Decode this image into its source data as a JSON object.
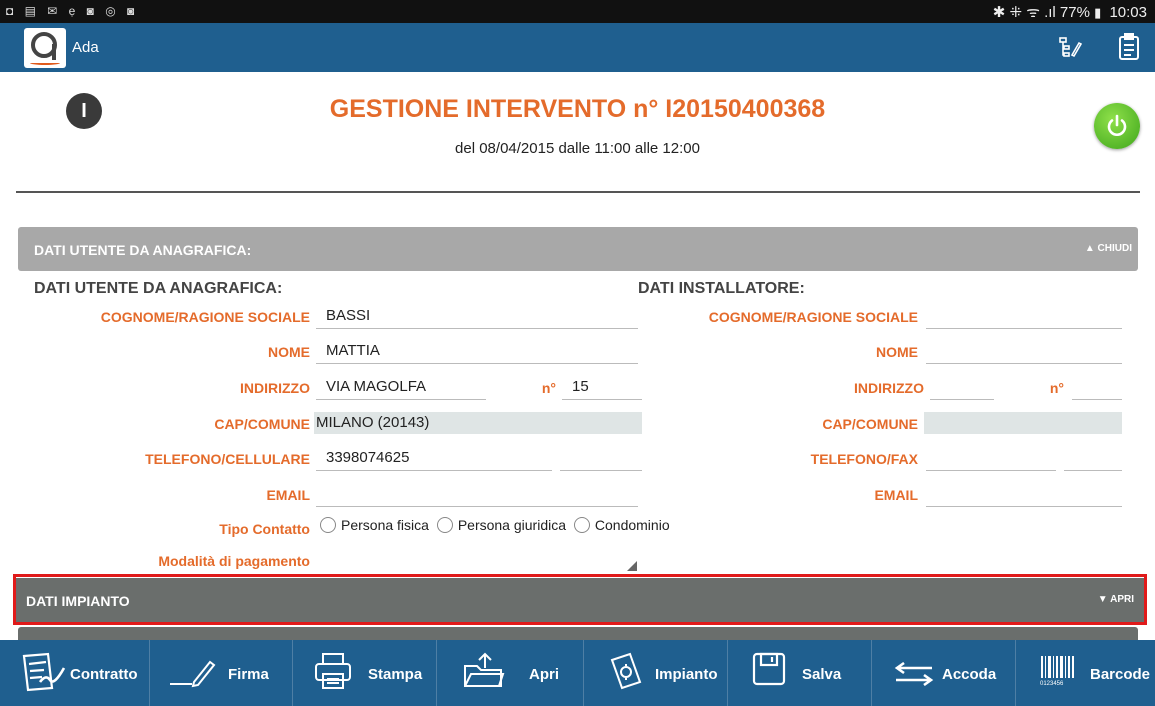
{
  "statusbar": {
    "left_icons": "◘ ▤ ✉ ẹ ◙ ◎ ◙",
    "signal": "✱ ⁜ ᯤ .ıl",
    "battery": "77%",
    "battery_icon": "▮",
    "time": "10:03"
  },
  "app": {
    "name": "Ada",
    "logo_letter": "a",
    "accent": "#1f5f8f",
    "orange": "#e46b2b"
  },
  "header": {
    "info_icon": "I",
    "title": "GESTIONE INTERVENTO n° I20150400368",
    "subtitle": "del 08/04/2015 dalle 11:00 alle 12:00"
  },
  "section_anagrafica": {
    "label": "DATI UTENTE DA ANAGRAFICA:",
    "toggle": "CHIUDI"
  },
  "utente": {
    "heading": "DATI UTENTE DA ANAGRAFICA:",
    "cognome_label": "COGNOME/RAGIONE SOCIALE",
    "cognome": "BASSI",
    "nome_label": "NOME",
    "nome": "MATTIA",
    "indirizzo_label": "INDIRIZZO",
    "indirizzo": "VIA MAGOLFA",
    "numero_label": "n°",
    "numero": "15",
    "cap_label": "CAP/COMUNE",
    "cap": "MILANO (20143)",
    "telefono_label": "TELEFONO/CELLULARE",
    "telefono": "3398074625",
    "cellulare": "",
    "email_label": "EMAIL",
    "email": "",
    "tipo_label": "Tipo Contatto",
    "tipo_options": [
      "Persona fisica",
      "Persona giuridica",
      "Condominio"
    ],
    "pagamento_label": "Modalità di pagamento",
    "pagamento": ""
  },
  "installatore": {
    "heading": "DATI INSTALLATORE:",
    "cognome_label": "COGNOME/RAGIONE SOCIALE",
    "nome_label": "NOME",
    "indirizzo_label": "INDIRIZZO",
    "numero_label": "n°",
    "cap_label": "CAP/COMUNE",
    "telefono_label": "TELEFONO/FAX",
    "email_label": "EMAIL"
  },
  "section_impianto": {
    "label": "DATI IMPIANTO",
    "toggle": "APRI"
  },
  "toolbar": {
    "contratto": "Contratto",
    "firma": "Firma",
    "stampa": "Stampa",
    "apri": "Apri",
    "impianto": "Impianto",
    "salva": "Salva",
    "accoda": "Accoda",
    "barcode": "Barcode",
    "barcode_digits": "0123456"
  }
}
